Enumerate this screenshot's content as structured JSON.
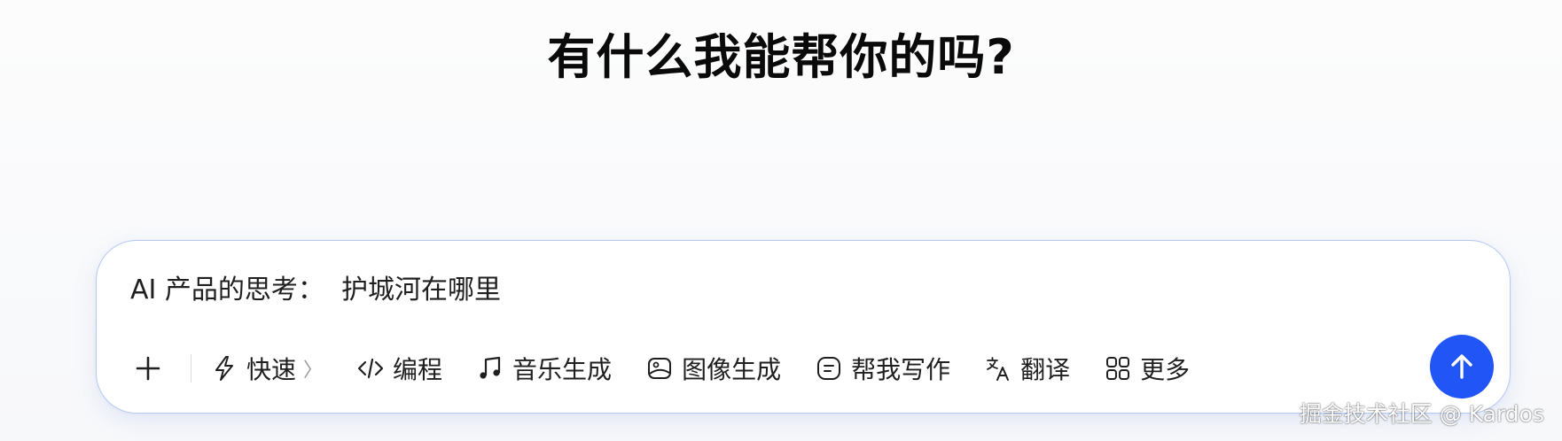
{
  "page": {
    "heading": "有什么我能帮你的吗?"
  },
  "composer": {
    "input_value": "AI 产品的思考：  护城河在哪里",
    "add_icon": "plus-icon",
    "send_icon": "arrow-up-icon",
    "accent_color": "#2155f5",
    "tools": [
      {
        "label": "快速",
        "icon": "lightning-icon"
      },
      {
        "label": "编程",
        "icon": "code-icon"
      },
      {
        "label": "音乐生成",
        "icon": "music-note-icon"
      },
      {
        "label": "图像生成",
        "icon": "image-icon"
      },
      {
        "label": "帮我写作",
        "icon": "writing-icon"
      },
      {
        "label": "翻译",
        "icon": "translate-icon"
      },
      {
        "label": "更多",
        "icon": "grid-icon"
      }
    ]
  },
  "watermark": {
    "text": "掘金技术社区 @ Kardos"
  }
}
